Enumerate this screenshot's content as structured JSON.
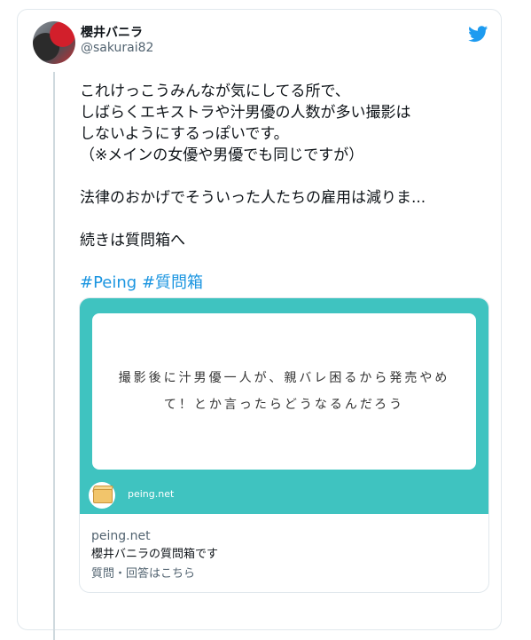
{
  "user": {
    "display_name": "櫻井バニラ",
    "handle": "@sakurai82"
  },
  "icons": {
    "platform": "twitter-bird-icon",
    "brand_color": "#1d9bf0"
  },
  "tweet": {
    "paragraph1": "これけっこうみんなが気にしてる所で、\nしばらくエキストラや汁男優の人数が多い撮影は\nしないようにするっぽいです。\n（※メインの女優や男優でも同じですが）",
    "paragraph2": "法律のおかげでそういった人たちの雇用は減りま...",
    "paragraph3": "続きは質問箱へ",
    "hashtag1": "#Peing",
    "hashtag2": "#質問箱",
    "hashtag_color": "#1b95e0"
  },
  "card": {
    "question": "撮影後に汁男優一人が、親バレ困るから発売やめて！とか言ったらどうなるんだろう",
    "image_domain": "peing.net",
    "image_bg_color": "#3fc3c0",
    "domain": "peing.net",
    "title": "櫻井バニラの質問箱です",
    "description": "質問・回答はこちら"
  }
}
